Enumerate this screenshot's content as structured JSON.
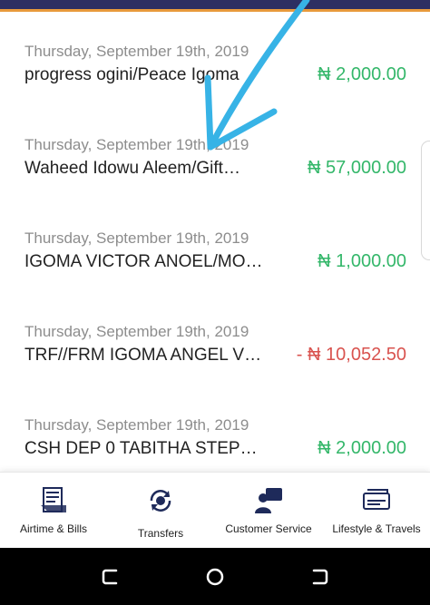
{
  "colors": {
    "positive": "#34b76a",
    "negative": "#d9534f",
    "header": "#2d2f62",
    "annotation_arrow": "#37b3e6"
  },
  "transactions": [
    {
      "date": "Thursday, September 19th, 2019",
      "description": "progress ogini/Peace Igoma",
      "amount": "₦ 2,000.00",
      "type": "credit"
    },
    {
      "date": "Thursday, September 19th, 2019",
      "description": "Waheed Idowu Aleem/Gift…",
      "amount": "₦ 57,000.00",
      "type": "credit"
    },
    {
      "date": "Thursday, September 19th, 2019",
      "description": "IGOMA VICTOR ANOEL/MO…",
      "amount": "₦ 1,000.00",
      "type": "credit"
    },
    {
      "date": "Thursday, September 19th, 2019",
      "description": "TRF//FRM IGOMA ANGEL V…",
      "amount": "- ₦ 10,052.50",
      "type": "debit"
    },
    {
      "date": "Thursday, September 19th, 2019",
      "description": "CSH DEP 0 TABITHA STEP…",
      "amount": "₦ 2,000.00",
      "type": "credit"
    }
  ],
  "bottom_nav": [
    {
      "label": "Airtime & Bills",
      "icon": "bill-receipt-icon"
    },
    {
      "label": "Transfers",
      "icon": "transfer-cycle-icon"
    },
    {
      "label": "Customer Service",
      "icon": "customer-service-icon"
    },
    {
      "label": "Lifestyle & Travels",
      "icon": "ticket-icon"
    }
  ],
  "system_nav": {
    "recents_icon": "recents-icon",
    "home_icon": "home-circle-icon",
    "back_icon": "back-icon"
  }
}
